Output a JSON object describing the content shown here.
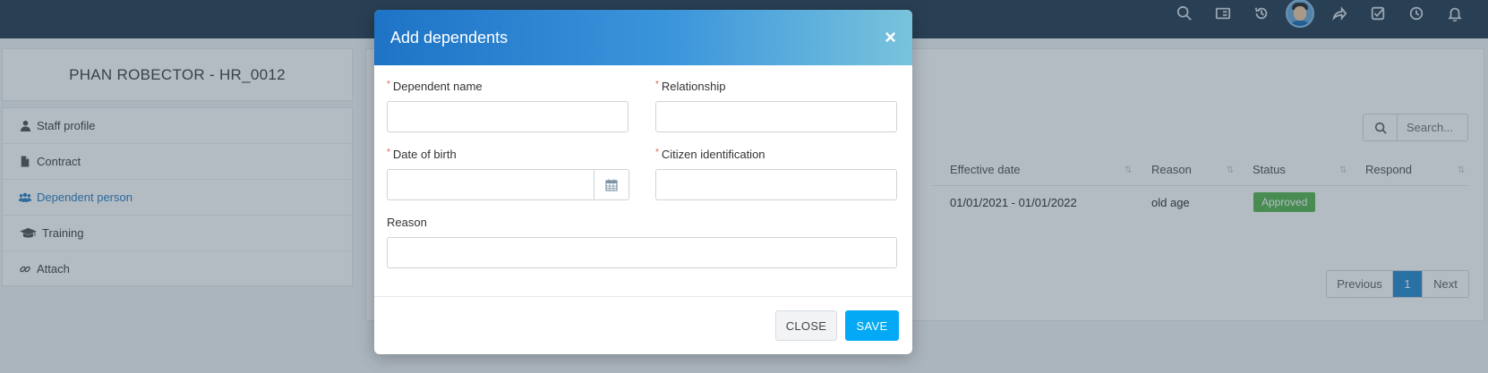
{
  "topbar": {
    "icons": [
      "search-icon",
      "id-card-icon",
      "history-icon",
      "avatar",
      "share-icon",
      "check-square-icon",
      "clock-icon",
      "bell-icon"
    ]
  },
  "profile": {
    "name": "PHAN ROBECTOR - HR_0012"
  },
  "sidebar": {
    "items": [
      {
        "label": "Staff profile",
        "icon": "user-icon"
      },
      {
        "label": "Contract",
        "icon": "file-icon"
      },
      {
        "label": "Dependent person",
        "icon": "users-icon",
        "active": true
      },
      {
        "label": "Training",
        "icon": "graduation-cap-icon"
      },
      {
        "label": "Attach",
        "icon": "link-icon"
      }
    ]
  },
  "table": {
    "search_placeholder": "Search...",
    "headers": {
      "effective_date": "Effective date",
      "reason": "Reason",
      "status": "Status",
      "respond": "Respond"
    },
    "rows": [
      {
        "effective_date": "01/01/2021 - 01/01/2022",
        "reason": "old age",
        "status": "Approved",
        "respond": ""
      }
    ],
    "pagination": {
      "previous": "Previous",
      "current": "1",
      "next": "Next"
    }
  },
  "modal": {
    "title": "Add dependents",
    "close_symbol": "×",
    "fields": {
      "dependent_name": {
        "label": "Dependent name",
        "required": true,
        "value": ""
      },
      "relationship": {
        "label": "Relationship",
        "required": true,
        "value": ""
      },
      "date_of_birth": {
        "label": "Date of birth",
        "required": true,
        "value": ""
      },
      "citizen_identification": {
        "label": "Citizen identification",
        "required": true,
        "value": ""
      },
      "reason": {
        "label": "Reason",
        "required": false,
        "value": ""
      }
    },
    "required_mark": "*",
    "buttons": {
      "close": "CLOSE",
      "save": "SAVE"
    }
  },
  "colors": {
    "topbar": "#2a3f54",
    "accent": "#03a9f4",
    "approved": "#5ab552",
    "active_menu": "#2a7fc3"
  }
}
